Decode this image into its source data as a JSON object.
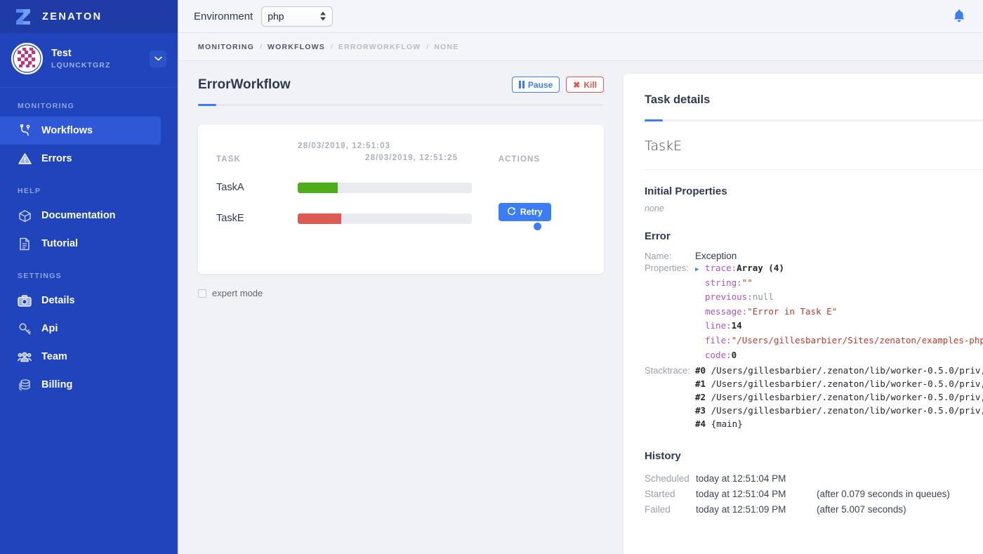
{
  "brand": {
    "name": "ZENATON",
    "logo_icon": "zenaton-z-logo"
  },
  "account": {
    "name": "Test",
    "id": "LQUNCKTGRZ",
    "caret_icon": "chevron-down-icon",
    "avatar_icon": "identicon-avatar"
  },
  "sidebar": {
    "sections": [
      {
        "label": "MONITORING",
        "items": [
          {
            "label": "Workflows",
            "icon": "workflow-branch-icon",
            "active": true
          },
          {
            "label": "Errors",
            "icon": "warning-triangle-icon",
            "active": false
          }
        ]
      },
      {
        "label": "HELP",
        "items": [
          {
            "label": "Documentation",
            "icon": "box-icon",
            "active": false
          },
          {
            "label": "Tutorial",
            "icon": "document-icon",
            "active": false
          }
        ]
      },
      {
        "label": "SETTINGS",
        "items": [
          {
            "label": "Details",
            "icon": "camera-icon",
            "active": false
          },
          {
            "label": "Api",
            "icon": "key-icon",
            "active": false
          },
          {
            "label": "Team",
            "icon": "people-icon",
            "active": false
          },
          {
            "label": "Billing",
            "icon": "database-stack-icon",
            "active": false
          }
        ]
      }
    ]
  },
  "topbar": {
    "environment_label": "Environment",
    "environment_value": "php",
    "environment_options": [
      "php"
    ],
    "bell_icon": "notification-bell-icon"
  },
  "breadcrumb": [
    {
      "label": "MONITORING",
      "dim": false
    },
    {
      "label": "WORKFLOWS",
      "dim": false
    },
    {
      "label": "ERRORWORKFLOW",
      "dim": true
    },
    {
      "label": "NONE",
      "dim": true
    }
  ],
  "workflow": {
    "title": "ErrorWorkflow",
    "pause_label": "Pause",
    "pause_icon": "pause-icon",
    "kill_label": "Kill",
    "kill_icon": "close-x-icon",
    "columns": {
      "task": "TASK",
      "date_start": "28/03/2019, 12:51:03",
      "date_end": "28/03/2019, 12:51:25",
      "actions": "ACTIONS"
    },
    "rows": [
      {
        "name": "TaskA",
        "bar_percent": 23,
        "bar_color": "#4caf17",
        "has_retry": false,
        "has_dot": false
      },
      {
        "name": "TaskE",
        "bar_percent": 25,
        "bar_color": "#df5a53",
        "has_retry": true,
        "retry_label": "Retry",
        "retry_icon": "refresh-icon",
        "has_dot": true,
        "dot_color": "#3b7df6"
      }
    ],
    "expert_mode_label": "expert mode",
    "expert_mode_checked": false
  },
  "task_details": {
    "panel_title": "Task details",
    "task_name": "TaskE",
    "initial_properties_title": "Initial Properties",
    "initial_properties_value": "none",
    "error_title": "Error",
    "name_key": "Name:",
    "name_value": "Exception",
    "properties_key": "Properties:",
    "properties": [
      {
        "key": "trace:",
        "value": "Array (4)",
        "kind": "dark",
        "caret": true
      },
      {
        "key": "string:",
        "value": "\"\"",
        "kind": "string",
        "caret": false
      },
      {
        "key": "previous:",
        "value": "null",
        "kind": "null",
        "caret": false
      },
      {
        "key": "message:",
        "value": "\"Error in Task E\"",
        "kind": "string",
        "caret": false
      },
      {
        "key": "line:",
        "value": "14",
        "kind": "dark",
        "caret": false
      },
      {
        "key": "file:",
        "value": "\"/Users/gillesbarbier/Sites/zenaton/examples-php",
        "kind": "string",
        "caret": false
      },
      {
        "key": "code:",
        "value": "0",
        "kind": "dark",
        "caret": false
      }
    ],
    "stacktrace_key": "Stacktrace:",
    "stacktrace": [
      {
        "idx": "#0",
        "text": "/Users/gillesbarbier/.zenaton/lib/worker-0.5.0/priv,"
      },
      {
        "idx": "#1",
        "text": "/Users/gillesbarbier/.zenaton/lib/worker-0.5.0/priv,"
      },
      {
        "idx": "#2",
        "text": "/Users/gillesbarbier/.zenaton/lib/worker-0.5.0/priv,"
      },
      {
        "idx": "#3",
        "text": "/Users/gillesbarbier/.zenaton/lib/worker-0.5.0/priv,"
      },
      {
        "idx": "#4",
        "text": "{main}"
      }
    ],
    "history_title": "History",
    "history": [
      {
        "state": "Scheduled",
        "when": "today at 12:51:04 PM",
        "extra": ""
      },
      {
        "state": "Started",
        "when": "today at 12:51:04 PM",
        "extra": "(after 0.079 seconds in queues)"
      },
      {
        "state": "Failed",
        "when": "today at 12:51:09 PM",
        "extra": "(after 5.007 seconds)"
      }
    ]
  },
  "colors": {
    "sidebar_bg": "#2044bb",
    "accent_blue": "#3b7df6",
    "danger_red": "#e8544a",
    "success_green": "#4caf17",
    "fail_bar": "#df5a53",
    "page_bg": "#f1f2f6"
  }
}
